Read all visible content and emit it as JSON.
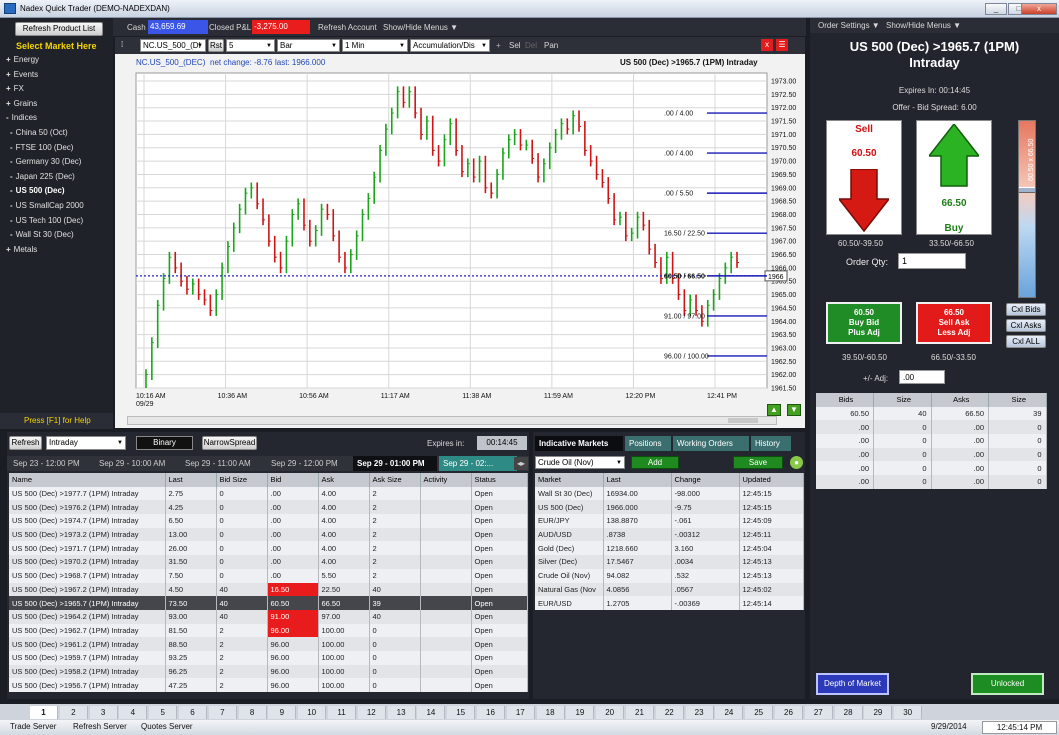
{
  "window": {
    "title": "Nadex Quick Trader (DEMO-NADEXDAN)",
    "buttons": [
      "_",
      "□",
      "x"
    ]
  },
  "topbar": {
    "refresh_product": "Refresh Product List",
    "cash_label": "Cash",
    "cash_value": "43,659.69",
    "pnl_label": "Closed P&L",
    "pnl_value": "-3,275.00",
    "refresh_account": "Refresh Account",
    "show_hide": "Show/Hide Menus ▼"
  },
  "right_top": {
    "order_settings": "Order Settings ▼",
    "show_hide": "Show/Hide Menus ▼"
  },
  "left": {
    "select_market": "Select Market Here",
    "help": "Press [F1] for Help",
    "items": [
      {
        "label": "Energy",
        "prefix": "+"
      },
      {
        "label": "Events",
        "prefix": "+"
      },
      {
        "label": "FX",
        "prefix": "+"
      },
      {
        "label": "Grains",
        "prefix": "+"
      },
      {
        "label": "Indices",
        "prefix": "-"
      },
      {
        "label": "China 50 (Oct)",
        "prefix": "-",
        "child": true
      },
      {
        "label": "FTSE 100 (Dec)",
        "prefix": "-",
        "child": true
      },
      {
        "label": "Germany 30 (Dec)",
        "prefix": "-",
        "child": true
      },
      {
        "label": "Japan 225 (Dec)",
        "prefix": "-",
        "child": true
      },
      {
        "label": "US 500 (Dec)",
        "prefix": "-",
        "child": true,
        "selected": true
      },
      {
        "label": "US SmallCap 2000",
        "prefix": "-",
        "child": true
      },
      {
        "label": "US Tech 100 (Dec)",
        "prefix": "-",
        "child": true
      },
      {
        "label": "Wall St 30 (Dec)",
        "prefix": "-",
        "child": true
      },
      {
        "label": "Metals",
        "prefix": "+"
      }
    ]
  },
  "chart_toolbar": {
    "symbol": "NC.US_500_(DI",
    "rst": "Rst",
    "rst_val": "5",
    "type": "Bar",
    "interval": "1 Min",
    "study": "Accumulation/Dis",
    "sel": "Sel",
    "del": "Del",
    "pan": "Pan"
  },
  "chart_header": {
    "left": "NC.US_500_(DEC)",
    "net": "net change: -8.76",
    "last": "last: 1966.000",
    "right": "US 500 (Dec) >1965.7 (1PM) Intraday"
  },
  "chart_data": {
    "type": "bar",
    "title": "US 500 (Dec) >1965.7 (1PM) Intraday",
    "ylim": [
      1961.5,
      1973.3
    ],
    "yticks": [
      "1973.00",
      "1972.50",
      "1972.00",
      "1971.50",
      "1971.00",
      "1970.50",
      "1970.00",
      "1969.50",
      "1969.00",
      "1968.50",
      "1968.00",
      "1967.50",
      "1967.00",
      "1966.50",
      "1966.00",
      "1965.50",
      "1965.00",
      "1964.50",
      "1964.00",
      "1963.50",
      "1963.00",
      "1962.50",
      "1962.00",
      "1961.50"
    ],
    "xticks": [
      "10:16 AM\n09/29",
      "10:36 AM",
      "10:56 AM",
      "11:17 AM",
      "11:38 AM",
      "11:59 AM",
      "12:20 PM",
      "12:41 PM"
    ],
    "last_price": 1965.7,
    "last_label": "1966",
    "levels": [
      {
        "label": ".00 / 4.00",
        "price": 1971.8
      },
      {
        "label": ".00 / 4.00",
        "price": 1970.3
      },
      {
        "label": ".00 / 5.50",
        "price": 1968.8
      },
      {
        "label": "16.50 / 22.50",
        "price": 1967.3
      },
      {
        "label": "60.50 / 66.50",
        "price": 1965.7,
        "bold": true
      },
      {
        "label": "91.00 / 97.00",
        "price": 1964.2
      },
      {
        "label": "96.00 / 100.00",
        "price": 1962.7
      }
    ],
    "closes": [
      1962.0,
      1963.2,
      1964.6,
      1965.6,
      1966.4,
      1966.0,
      1965.5,
      1965.2,
      1965.4,
      1965.0,
      1964.8,
      1964.4,
      1965.0,
      1966.0,
      1966.8,
      1967.5,
      1968.2,
      1968.8,
      1969.0,
      1968.4,
      1967.8,
      1967.0,
      1966.4,
      1966.0,
      1967.0,
      1968.0,
      1968.4,
      1967.6,
      1967.0,
      1967.4,
      1968.2,
      1968.0,
      1967.2,
      1966.4,
      1966.0,
      1966.5,
      1967.2,
      1968.0,
      1968.6,
      1969.4,
      1970.4,
      1971.2,
      1971.8,
      1972.6,
      1972.2,
      1972.6,
      1971.8,
      1971.0,
      1971.5,
      1970.4,
      1970.0,
      1970.8,
      1971.4,
      1970.4,
      1969.6,
      1969.9,
      1969.4,
      1970.0,
      1969.0,
      1968.8,
      1969.5,
      1970.3,
      1970.8,
      1971.0,
      1970.6,
      1970.6,
      1970.1,
      1969.4,
      1969.9,
      1970.5,
      1971.0,
      1971.4,
      1971.2,
      1971.7,
      1971.3,
      1970.4,
      1970.0,
      1969.5,
      1969.2,
      1968.6,
      1967.8,
      1967.9,
      1967.2,
      1967.3,
      1967.9,
      1967.6,
      1966.7,
      1966.2,
      1965.6,
      1966.4,
      1965.6,
      1965.0,
      1964.4,
      1964.8,
      1964.4,
      1964.0,
      1964.6,
      1965.0,
      1965.6,
      1966.0,
      1966.4,
      1966.2
    ]
  },
  "binary": {
    "refresh": "Refresh",
    "period": "Intraday",
    "binary_btn": "Binary",
    "narrow_btn": "NarrowSpread",
    "expires_label": "Expires in:",
    "expires_value": "00:14:45",
    "date_tabs": [
      "Sep 23 - 12:00 PM",
      "Sep 29 - 10:00 AM",
      "Sep 29 - 11:00 AM",
      "Sep 29 - 12:00 PM",
      "Sep 29 - 01:00 PM",
      "Sep 29 - 02:..."
    ],
    "columns": [
      "Name",
      "Last",
      "Bid Size",
      "Bid",
      "Ask",
      "Ask Size",
      "Activity",
      "Status"
    ],
    "rows": [
      [
        "US 500 (Dec) >1977.7 (1PM) Intraday",
        "2.75",
        "0",
        ".00",
        "4.00",
        "2",
        "",
        "Open"
      ],
      [
        "US 500 (Dec) >1976.2 (1PM) Intraday",
        "4.25",
        "0",
        ".00",
        "4.00",
        "2",
        "",
        "Open"
      ],
      [
        "US 500 (Dec) >1974.7 (1PM) Intraday",
        "6.50",
        "0",
        ".00",
        "4.00",
        "2",
        "",
        "Open"
      ],
      [
        "US 500 (Dec) >1973.2 (1PM) Intraday",
        "13.00",
        "0",
        ".00",
        "4.00",
        "2",
        "",
        "Open"
      ],
      [
        "US 500 (Dec) >1971.7 (1PM) Intraday",
        "26.00",
        "0",
        ".00",
        "4.00",
        "2",
        "",
        "Open"
      ],
      [
        "US 500 (Dec) >1970.2 (1PM) Intraday",
        "31.50",
        "0",
        ".00",
        "4.00",
        "2",
        "",
        "Open"
      ],
      [
        "US 500 (Dec) >1968.7 (1PM) Intraday",
        "7.50",
        "0",
        ".00",
        "5.50",
        "2",
        "",
        "Open"
      ],
      [
        "US 500 (Dec) >1967.2 (1PM) Intraday",
        "4.50",
        "40",
        "16.50",
        "22.50",
        "40",
        "",
        "Open"
      ],
      [
        "US 500 (Dec) >1965.7 (1PM) Intraday",
        "73.50",
        "40",
        "60.50",
        "66.50",
        "39",
        "",
        "Open"
      ],
      [
        "US 500 (Dec) >1964.2 (1PM) Intraday",
        "93.00",
        "40",
        "91.00",
        "97.00",
        "40",
        "",
        "Open"
      ],
      [
        "US 500 (Dec) >1962.7 (1PM) Intraday",
        "81.50",
        "2",
        "96.00",
        "100.00",
        "0",
        "",
        "Open"
      ],
      [
        "US 500 (Dec) >1961.2 (1PM) Intraday",
        "88.50",
        "2",
        "96.00",
        "100.00",
        "0",
        "",
        "Open"
      ],
      [
        "US 500 (Dec) >1959.7 (1PM) Intraday",
        "93.25",
        "2",
        "96.00",
        "100.00",
        "0",
        "",
        "Open"
      ],
      [
        "US 500 (Dec) >1958.2 (1PM) Intraday",
        "96.25",
        "2",
        "96.00",
        "100.00",
        "0",
        "",
        "Open"
      ],
      [
        "US 500 (Dec) >1956.7 (1PM) Intraday",
        "47.25",
        "2",
        "96.00",
        "100.00",
        "0",
        "",
        "Open"
      ]
    ]
  },
  "indicative": {
    "tabs": [
      "Indicative Markets",
      "Positions",
      "Working Orders",
      "History"
    ],
    "select": "Crude Oil (Nov)",
    "add": "Add",
    "save": "Save",
    "columns": [
      "Market",
      "Last",
      "Change",
      "Updated"
    ],
    "rows": [
      [
        "Wall St 30 (Dec)",
        "16934.00",
        "-98.000",
        "12:45:15"
      ],
      [
        "US 500 (Dec)",
        "1966.000",
        "-9.75",
        "12:45:15"
      ],
      [
        "EUR/JPY",
        "138.8870",
        "-.061",
        "12:45:09"
      ],
      [
        "AUD/USD",
        ".8738",
        "-.00312",
        "12:45:11"
      ],
      [
        "Gold (Dec)",
        "1218.660",
        "3.160",
        "12:45:04"
      ],
      [
        "Silver (Dec)",
        "17.5467",
        ".0034",
        "12:45:13"
      ],
      [
        "Crude Oil (Nov)",
        "94.082",
        ".532",
        "12:45:13"
      ],
      [
        "Natural Gas (Nov",
        "4.0856",
        ".0567",
        "12:45:02"
      ],
      [
        "EUR/USD",
        "1.2705",
        "-.00369",
        "12:45:14"
      ]
    ]
  },
  "ticket": {
    "title": "US 500 (Dec) >1965.7 (1PM) Intraday",
    "expires": "Expires In: 00:14:45",
    "spread": "Offer - Bid Spread: 6.00",
    "sell_label": "Sell",
    "sell_price": "60.50",
    "buy_label": "Buy",
    "buy_price": "66.50",
    "sell_sub": "60.50/-39.50",
    "buy_sub": "33.50/-66.50",
    "qty_label": "Order Qty:",
    "qty_value": "1",
    "vertical_label": "60.50 x 66.50",
    "bid_btn": "60.50\nBuy Bid\nPlus Adj",
    "ask_btn": "66.50\nSell Ask\nLess Adj",
    "bid_sub": "39.50/-60.50",
    "ask_sub": "66.50/-33.50",
    "adj_label": "+/- Adj:",
    "adj_value": ".00",
    "cxl": [
      "Cxl Bids",
      "Cxl Asks",
      "Cxl ALL"
    ],
    "depth_columns": [
      "Bids",
      "Size",
      "Asks",
      "Size"
    ],
    "depth_rows": [
      [
        "60.50",
        "40",
        "66.50",
        "39"
      ],
      [
        ".00",
        "0",
        ".00",
        "0"
      ],
      [
        ".00",
        "0",
        ".00",
        "0"
      ],
      [
        ".00",
        "0",
        ".00",
        "0"
      ],
      [
        ".00",
        "0",
        ".00",
        "0"
      ],
      [
        ".00",
        "0",
        ".00",
        "0"
      ]
    ],
    "depth_btn": "Depth of Market",
    "unlocked": "Unlocked"
  },
  "bottom_numbers": [
    "1",
    "2",
    "3",
    "4",
    "5",
    "6",
    "7",
    "8",
    "9",
    "10",
    "11",
    "12",
    "13",
    "14",
    "15",
    "16",
    "17",
    "18",
    "19",
    "20",
    "21",
    "22",
    "23",
    "24",
    "25",
    "26",
    "27",
    "28",
    "29",
    "30"
  ],
  "status": {
    "trade": "Trade Server",
    "refresh": "Refresh Server",
    "quotes": "Quotes Server",
    "date": "9/29/2014",
    "time": "12:45:14 PM"
  }
}
